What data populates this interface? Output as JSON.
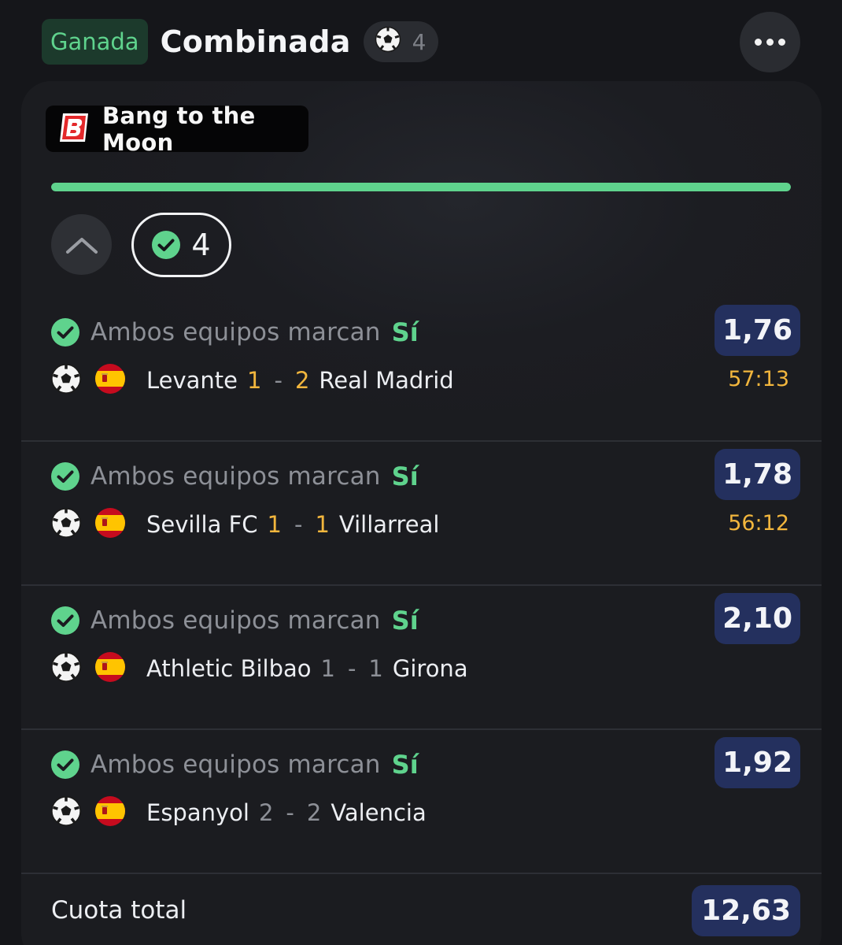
{
  "header": {
    "status_badge": "Ganada",
    "title": "Combinada",
    "sport_icon": "soccer-ball-icon",
    "selection_count": "4",
    "more_icon": "more-horizontal-icon"
  },
  "card": {
    "promo": {
      "logo": "bangbet-logo",
      "label": "Bang to the Moon"
    },
    "progress": {
      "fraction": 1.0,
      "color": "#5fd38d"
    },
    "collapse_icon": "chevron-up-icon",
    "won_count": "4",
    "selections": [
      {
        "market": "Ambos equipos marcan",
        "pick": "Sí",
        "odds": "1,76",
        "home_team": "Levante",
        "home_score": "1",
        "away_score": "2",
        "away_team": "Real Madrid",
        "clock": "57:13",
        "score_state": "live"
      },
      {
        "market": "Ambos equipos marcan",
        "pick": "Sí",
        "odds": "1,78",
        "home_team": "Sevilla FC",
        "home_score": "1",
        "away_score": "1",
        "away_team": "Villarreal",
        "clock": "56:12",
        "score_state": "live"
      },
      {
        "market": "Ambos equipos marcan",
        "pick": "Sí",
        "odds": "2,10",
        "home_team": "Athletic Bilbao",
        "home_score": "1",
        "away_score": "1",
        "away_team": "Girona",
        "clock": "",
        "score_state": "final"
      },
      {
        "market": "Ambos equipos marcan",
        "pick": "Sí",
        "odds": "1,92",
        "home_team": "Espanyol",
        "home_score": "2",
        "away_score": "2",
        "away_team": "Valencia",
        "clock": "",
        "score_state": "final"
      }
    ],
    "total": {
      "label": "Cuota total",
      "odds": "12,63"
    }
  },
  "colors": {
    "accent_green": "#5fd38d",
    "live_yellow": "#f2b63d",
    "odds_bg": "#24305e"
  },
  "icons": {
    "check": "check-circle-icon",
    "sport": "soccer-ball-icon",
    "flag": "spain-flag-icon"
  }
}
